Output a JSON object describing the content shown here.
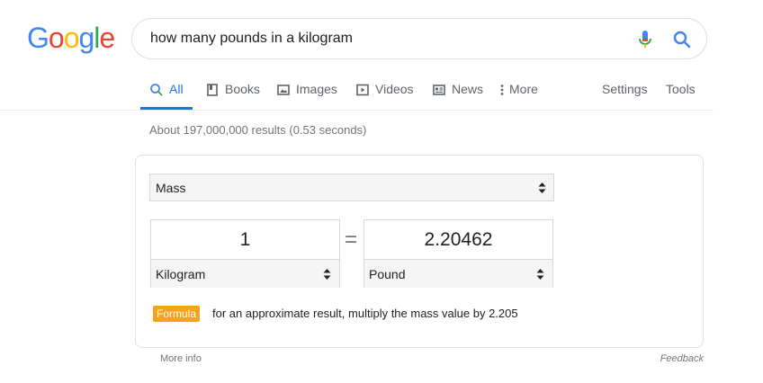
{
  "logo": {
    "letters": [
      "G",
      "o",
      "o",
      "g",
      "l",
      "e"
    ],
    "colors": [
      "#4285f4",
      "#ea4335",
      "#fbbc05",
      "#4285f4",
      "#34a853",
      "#ea4335"
    ]
  },
  "search": {
    "query": "how many pounds in a kilogram"
  },
  "tabs": [
    {
      "label": "All",
      "icon": "search-icon",
      "active": true
    },
    {
      "label": "Books",
      "icon": "book-icon"
    },
    {
      "label": "Images",
      "icon": "image-icon"
    },
    {
      "label": "Videos",
      "icon": "play-icon"
    },
    {
      "label": "News",
      "icon": "news-icon"
    },
    {
      "label": "More",
      "icon": "more-vert-icon"
    }
  ],
  "tools": {
    "settings": "Settings",
    "tools": "Tools"
  },
  "result_stats": "About 197,000,000 results (0.53 seconds)",
  "converter": {
    "quantity": "Mass",
    "from": {
      "value": "1",
      "unit": "Kilogram"
    },
    "equals": "=",
    "to": {
      "value": "2.20462",
      "unit": "Pound"
    },
    "formula_label": "Formula",
    "formula_text": "for an approximate result, multiply the mass value by 2.205"
  },
  "footer": {
    "more_info": "More info",
    "feedback": "Feedback"
  },
  "colors": {
    "accent": "#1a73e8",
    "formula_badge": "#f7a21b"
  }
}
